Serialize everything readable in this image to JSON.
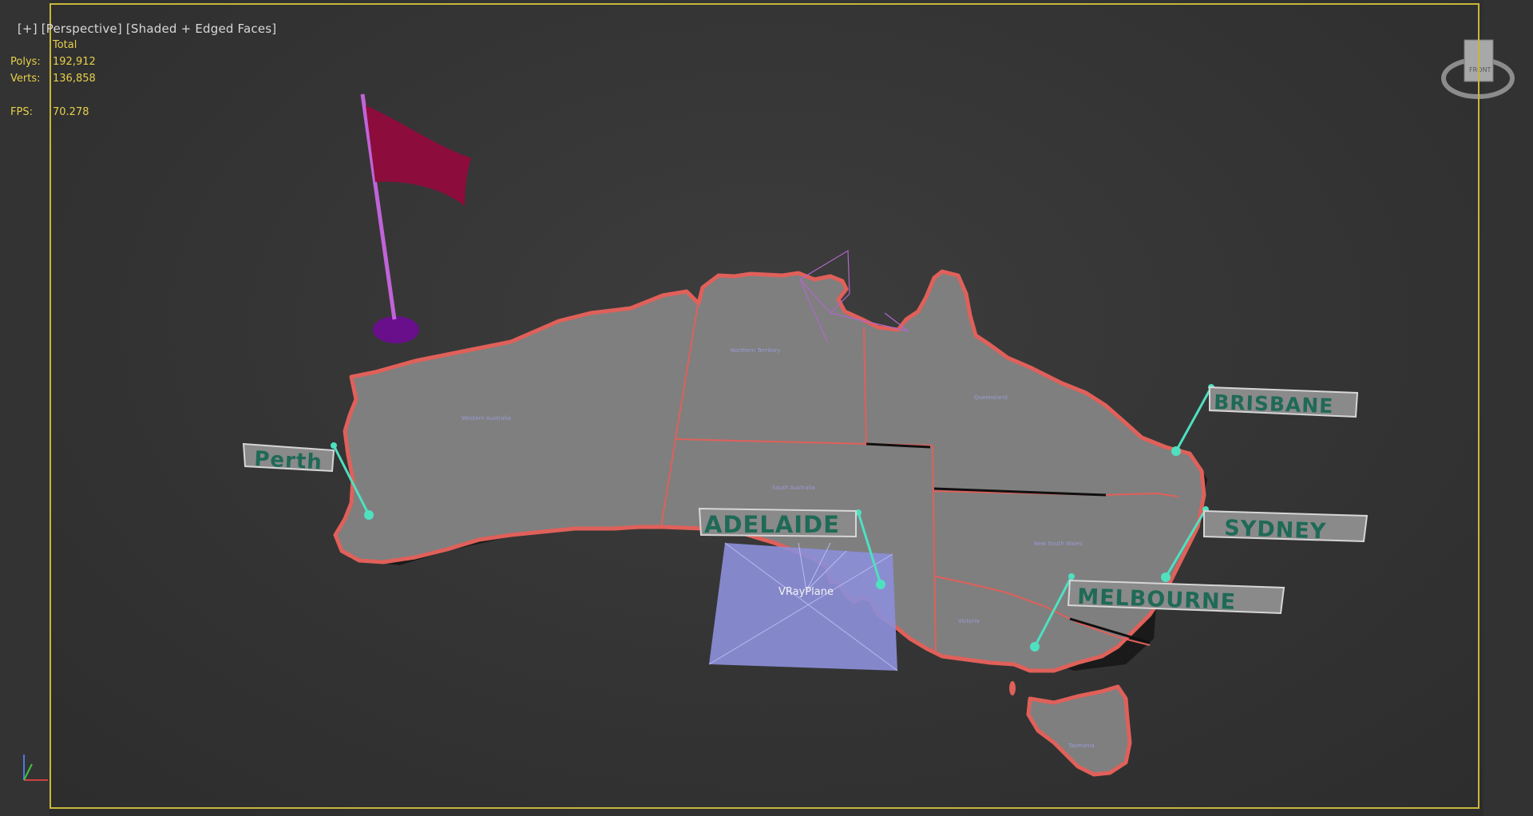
{
  "viewport": {
    "label_plus": "[+]",
    "label_view": "[Perspective]",
    "label_shading": "[Shaded + Edged Faces]"
  },
  "stats": {
    "total_label": "Total",
    "polys_label": "Polys:",
    "polys_value": "192,912",
    "verts_label": "Verts:",
    "verts_value": "136,858",
    "fps_label": "FPS:",
    "fps_value": "70.278"
  },
  "cities": {
    "perth": "Perth",
    "adelaide": "ADELAIDE",
    "brisbane": "BRISBANE",
    "sydney": "SYDNEY",
    "melbourne": "MELBOURNE"
  },
  "regions": {
    "wa": "Western Australia",
    "nt": "Northern Territory",
    "qld": "Queensland",
    "sa": "South Australia",
    "nsw": "New South Wales",
    "vic": "Victoria",
    "tas": "Tasmania"
  },
  "scene_objects": {
    "vray_plane_label": "VRayPlane"
  },
  "viewcube": {
    "face_label": "FRONT"
  },
  "colors": {
    "frame": "#c8b73a",
    "stats_text": "#e7cf4b",
    "land": "#7f7f7f",
    "coast_edge": "#e0605a",
    "leader_line": "#4fe0c0",
    "label_text": "#1f6a57",
    "flag": "#8c0d3c",
    "pole": "#c064d8",
    "plane": "#8c8ed8"
  }
}
